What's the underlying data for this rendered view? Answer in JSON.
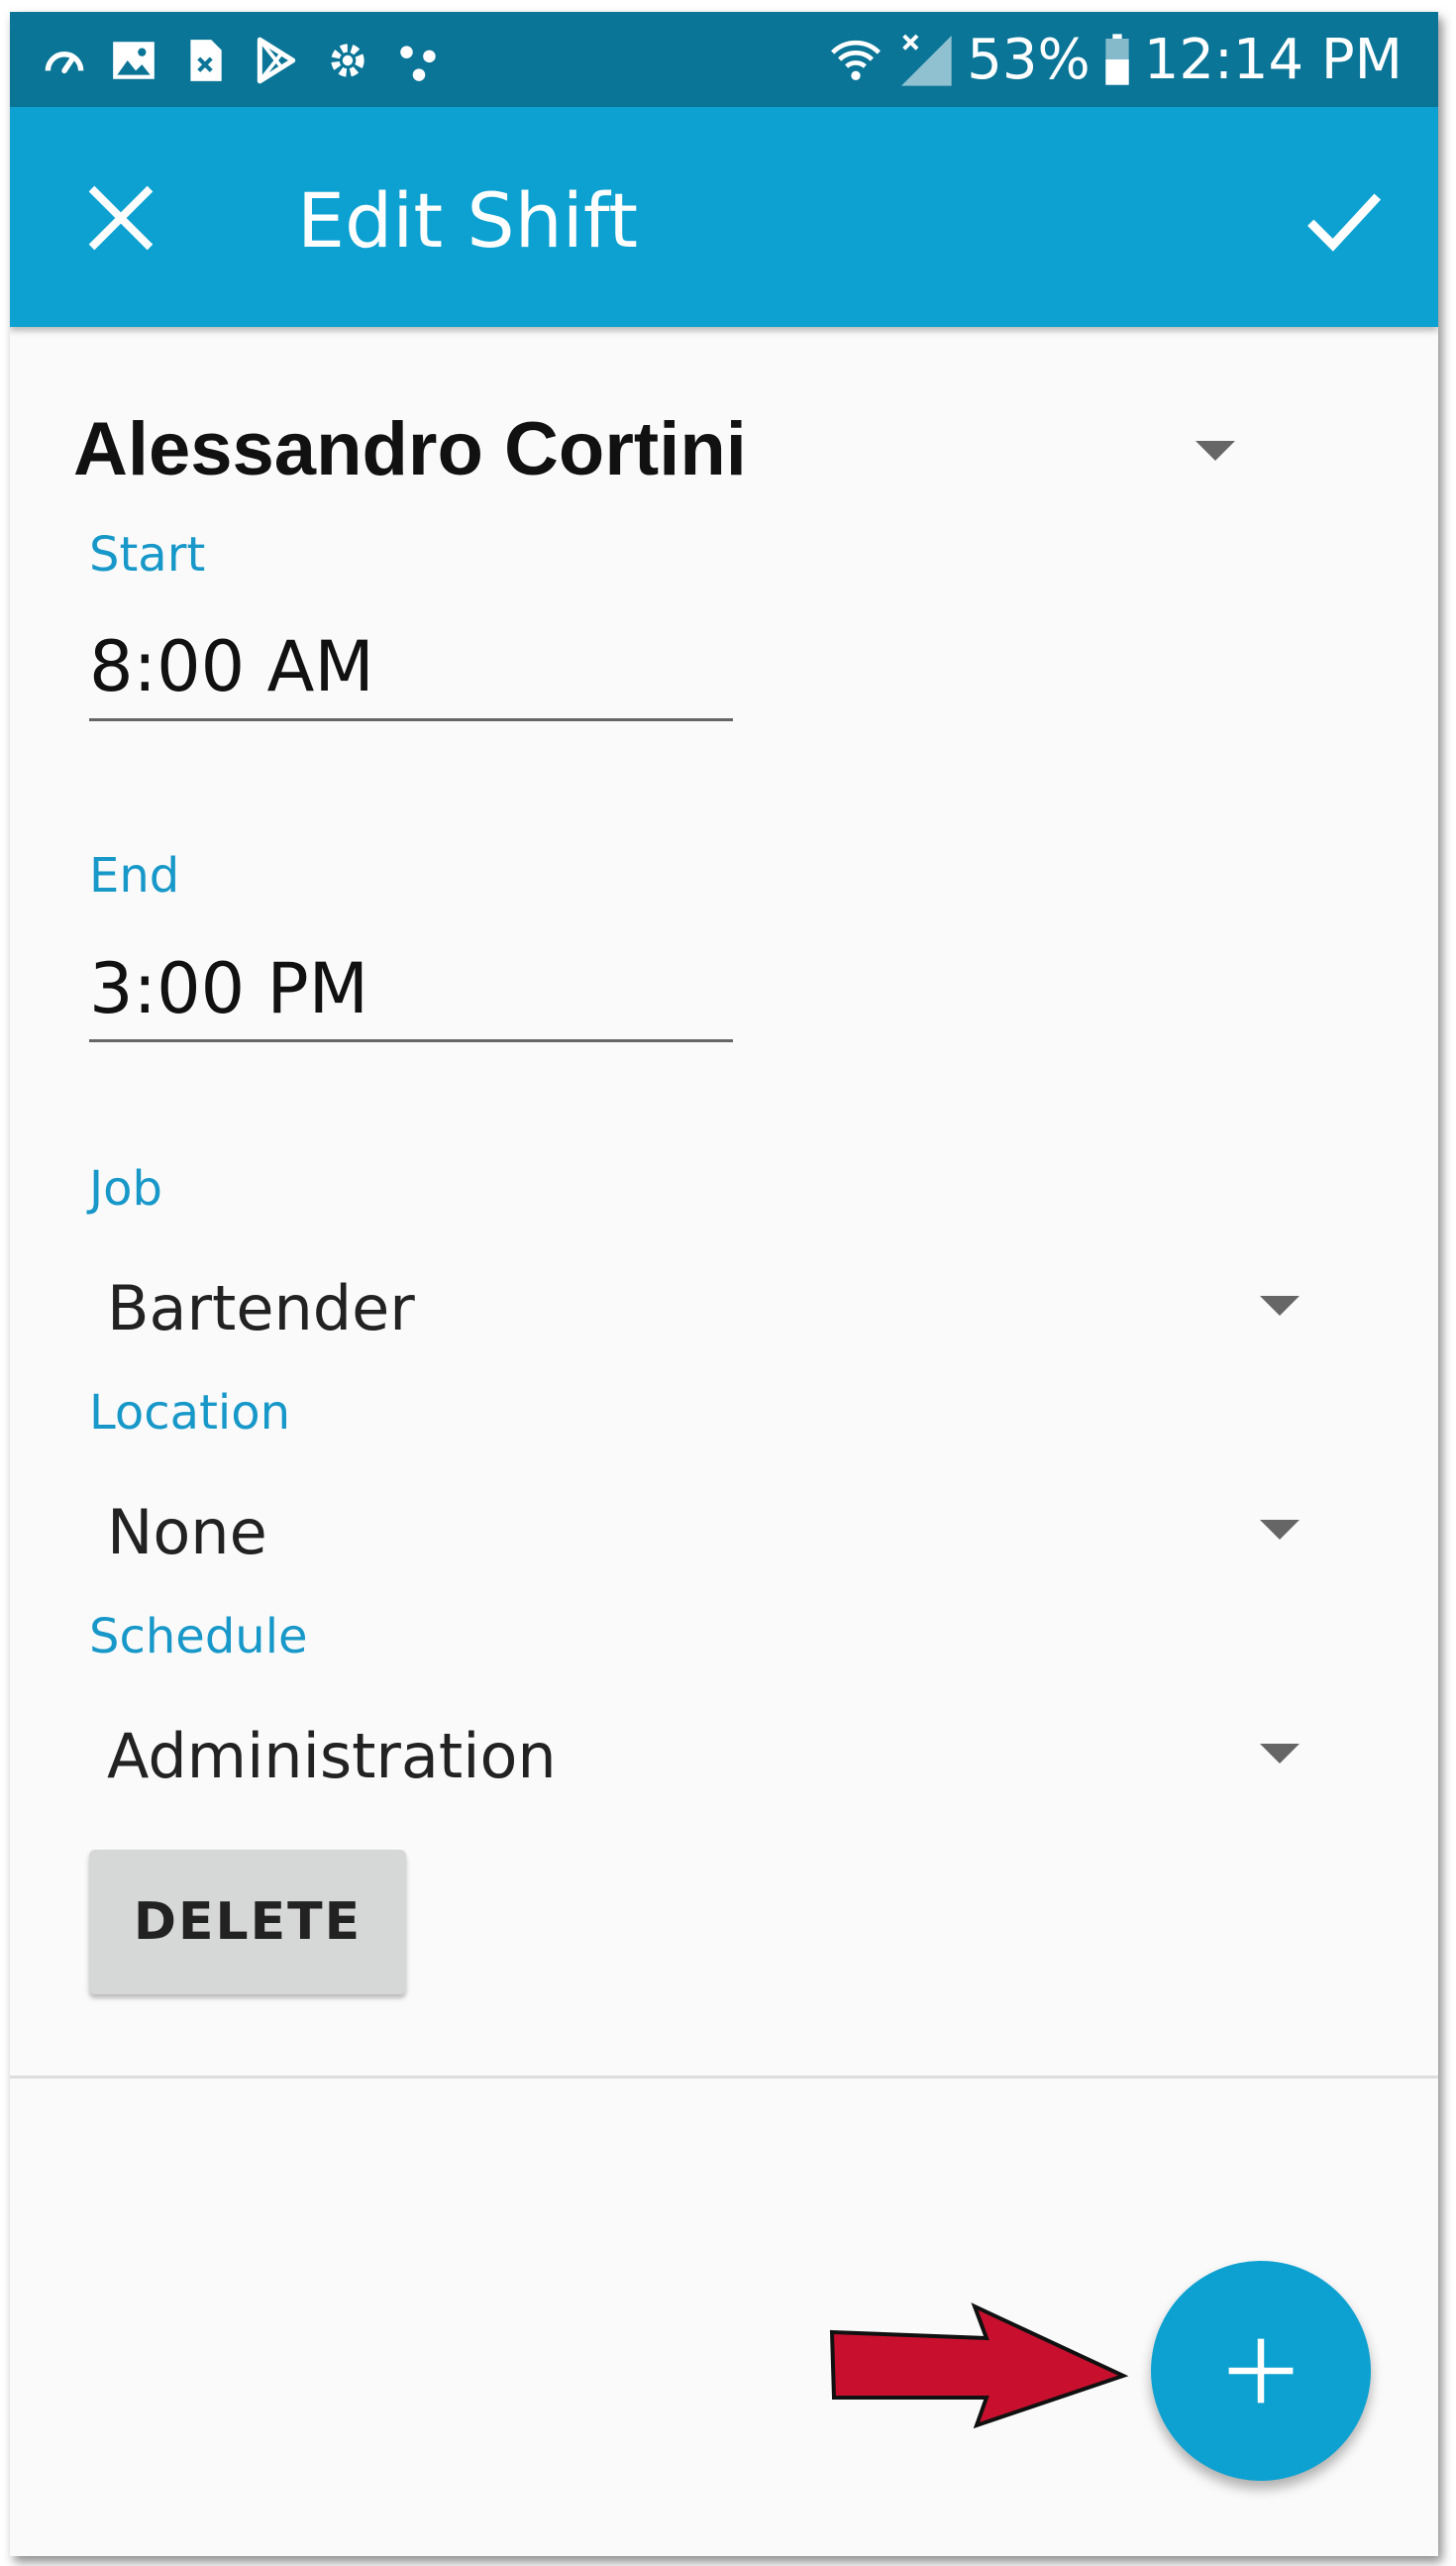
{
  "status_bar": {
    "battery": "53%",
    "time": "12:14 PM",
    "icons": [
      "speedometer-icon",
      "image-icon",
      "file-icon",
      "play-store-icon",
      "puzzle-gear-icon",
      "dots-icon",
      "wifi-icon",
      "signal-icon",
      "battery-icon"
    ]
  },
  "app_bar": {
    "title": "Edit Shift",
    "close_icon": "close-icon",
    "confirm_icon": "check-icon",
    "color": "#0da1d1"
  },
  "form": {
    "employee": "Alessandro Cortini",
    "start_label": "Start",
    "start_value": "8:00 AM",
    "end_label": "End",
    "end_value": "3:00 PM",
    "job_label": "Job",
    "job_value": "Bartender",
    "location_label": "Location",
    "location_value": "None",
    "schedule_label": "Schedule",
    "schedule_value": "Administration",
    "delete_label": "DELETE"
  },
  "fab": {
    "icon": "plus-icon",
    "color": "#0da1d1"
  },
  "annotation": {
    "icon": "red-arrow-icon",
    "color": "#c8102e"
  }
}
